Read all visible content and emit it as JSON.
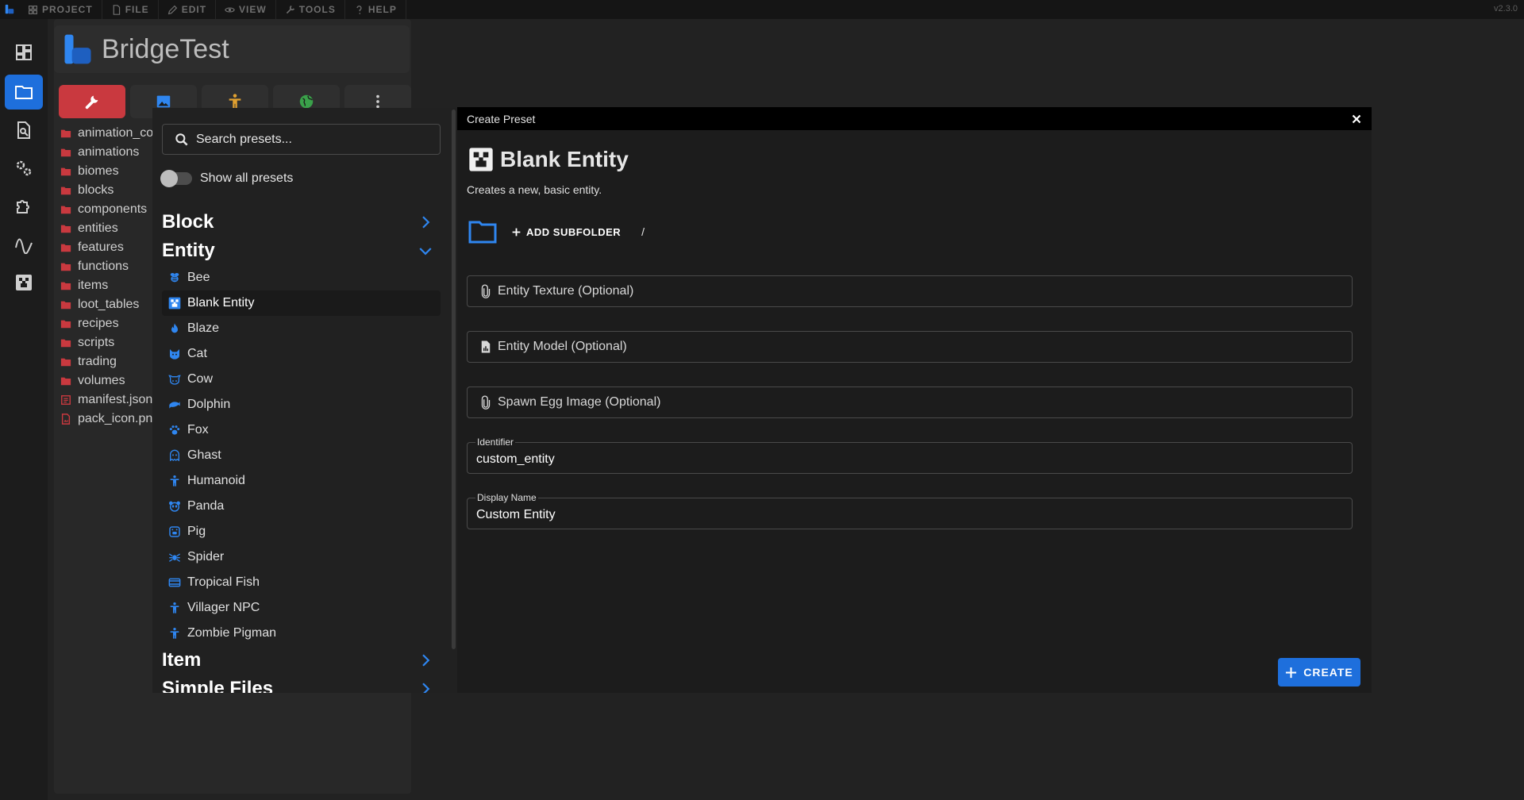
{
  "colors": {
    "accent": "#1e6fdc",
    "active_tool": "#c9393f",
    "icon_blue": "#2f86f0",
    "folder_red": "#c9393f"
  },
  "topbar": {
    "menus": [
      {
        "label": "PROJECT",
        "icon": "grid-icon"
      },
      {
        "label": "FILE",
        "icon": "file-icon"
      },
      {
        "label": "EDIT",
        "icon": "pencil-icon"
      },
      {
        "label": "VIEW",
        "icon": "eye-icon"
      },
      {
        "label": "TOOLS",
        "icon": "wrench-icon"
      },
      {
        "label": "HELP",
        "icon": "help-icon"
      }
    ],
    "version": "v2.3.0"
  },
  "rail": {
    "buttons": [
      "dashboard-icon",
      "folder-icon",
      "file-search-icon",
      "cogs-icon",
      "puzzle-icon",
      "waveform-icon",
      "creeper-icon"
    ],
    "active": "folder-icon"
  },
  "project": {
    "title": "BridgeTest"
  },
  "tool_tabs": [
    "wrench-icon",
    "image-icon",
    "humanoid-icon",
    "globe-icon",
    "more-vertical-icon"
  ],
  "file_tree": {
    "items": [
      {
        "label": "animation_controllers",
        "type": "folder"
      },
      {
        "label": "animations",
        "type": "folder"
      },
      {
        "label": "biomes",
        "type": "folder"
      },
      {
        "label": "blocks",
        "type": "folder"
      },
      {
        "label": "components",
        "type": "folder"
      },
      {
        "label": "entities",
        "type": "folder"
      },
      {
        "label": "features",
        "type": "folder"
      },
      {
        "label": "functions",
        "type": "folder"
      },
      {
        "label": "items",
        "type": "folder"
      },
      {
        "label": "loot_tables",
        "type": "folder"
      },
      {
        "label": "recipes",
        "type": "folder"
      },
      {
        "label": "scripts",
        "type": "folder"
      },
      {
        "label": "trading",
        "type": "folder"
      },
      {
        "label": "volumes",
        "type": "folder"
      },
      {
        "label": "manifest.json",
        "type": "json"
      },
      {
        "label": "pack_icon.png",
        "type": "image"
      }
    ]
  },
  "preset_sidebar": {
    "search_placeholder": "Search presets...",
    "show_all_label": "Show all presets",
    "categories": {
      "block": "Block",
      "entity": "Entity",
      "item": "Item",
      "simple_files": "Simple Files"
    },
    "entity_presets": [
      {
        "label": "Bee",
        "icon": "bee-icon"
      },
      {
        "label": "Blank Entity",
        "icon": "creeper-icon"
      },
      {
        "label": "Blaze",
        "icon": "fire-icon"
      },
      {
        "label": "Cat",
        "icon": "cat-icon"
      },
      {
        "label": "Cow",
        "icon": "cow-icon"
      },
      {
        "label": "Dolphin",
        "icon": "dolphin-icon"
      },
      {
        "label": "Fox",
        "icon": "paw-icon"
      },
      {
        "label": "Ghast",
        "icon": "ghost-icon"
      },
      {
        "label": "Humanoid",
        "icon": "humanoid-icon"
      },
      {
        "label": "Panda",
        "icon": "panda-icon"
      },
      {
        "label": "Pig",
        "icon": "pig-icon"
      },
      {
        "label": "Spider",
        "icon": "spider-icon"
      },
      {
        "label": "Tropical Fish",
        "icon": "fish-icon"
      },
      {
        "label": "Villager NPC",
        "icon": "humanoid-icon"
      },
      {
        "label": "Zombie Pigman",
        "icon": "humanoid-icon"
      }
    ],
    "selected": "Blank Entity"
  },
  "dialog": {
    "title": "Create Preset",
    "preset_name": "Blank Entity",
    "preset_description": "Creates a new, basic entity.",
    "add_subfolder_label": "ADD SUBFOLDER",
    "path_separator": "/",
    "fields": {
      "texture": "Entity Texture (Optional)",
      "model": "Entity Model (Optional)",
      "spawn_egg": "Spawn Egg Image (Optional)"
    },
    "identifier": {
      "label": "Identifier",
      "value": "custom_entity"
    },
    "display_name": {
      "label": "Display Name",
      "value": "Custom Entity"
    },
    "create_label": "CREATE"
  }
}
